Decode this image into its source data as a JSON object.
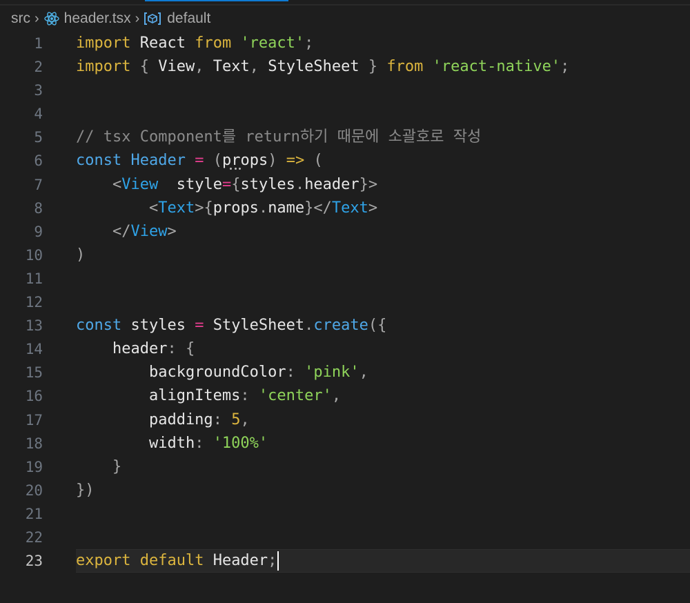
{
  "breadcrumb": {
    "folder": "src",
    "file": "header.tsx",
    "symbol": "default"
  },
  "icons": {
    "file": "react-icon",
    "symbol": "symbol-module-icon",
    "separator": "chevron-right-icon"
  },
  "colors": {
    "keyword": "#dcb53e",
    "string": "#8fd45a",
    "tag": "#2fa3e8",
    "comment": "#8b8b8b",
    "tab_accent": "#0e7ad3"
  },
  "editor": {
    "current_line": 23,
    "lines": [
      {
        "n": "1",
        "tokens": [
          [
            "kw",
            "import"
          ],
          [
            "id",
            " React "
          ],
          [
            "kw",
            "from"
          ],
          [
            "id",
            " "
          ],
          [
            "str",
            "'react'"
          ],
          [
            "punct",
            ";"
          ]
        ]
      },
      {
        "n": "2",
        "tokens": [
          [
            "kw",
            "import"
          ],
          [
            "punct",
            " { "
          ],
          [
            "id",
            "View"
          ],
          [
            "punct",
            ", "
          ],
          [
            "id",
            "Text"
          ],
          [
            "punct",
            ", "
          ],
          [
            "id",
            "StyleSheet"
          ],
          [
            "punct",
            " } "
          ],
          [
            "kw",
            "from"
          ],
          [
            "id",
            " "
          ],
          [
            "str",
            "'react-native'"
          ],
          [
            "punct",
            ";"
          ]
        ]
      },
      {
        "n": "3",
        "tokens": []
      },
      {
        "n": "4",
        "tokens": []
      },
      {
        "n": "5",
        "tokens": [
          [
            "comment",
            "// tsx Component를 return하기 때문에 소괄호로 작성"
          ]
        ]
      },
      {
        "n": "6",
        "tokens": [
          [
            "const",
            "const"
          ],
          [
            "id",
            " "
          ],
          [
            "fn",
            "Header"
          ],
          [
            "id",
            " "
          ],
          [
            "op",
            "="
          ],
          [
            "id",
            " "
          ],
          [
            "punct",
            "("
          ],
          [
            "id",
            "props"
          ],
          [
            "punct",
            ")"
          ],
          [
            "id",
            " "
          ],
          [
            "arrow",
            "=>"
          ],
          [
            "id",
            " "
          ],
          [
            "punct",
            "("
          ]
        ]
      },
      {
        "n": "7",
        "tokens": [
          [
            "id",
            "    "
          ],
          [
            "punct",
            "<"
          ],
          [
            "tag",
            "View"
          ],
          [
            "id",
            "  "
          ],
          [
            "prop",
            "style"
          ],
          [
            "op",
            "="
          ],
          [
            "punct",
            "{"
          ],
          [
            "id",
            "styles"
          ],
          [
            "punct",
            "."
          ],
          [
            "id",
            "header"
          ],
          [
            "punct",
            "}>"
          ]
        ]
      },
      {
        "n": "8",
        "tokens": [
          [
            "id",
            "        "
          ],
          [
            "punct",
            "<"
          ],
          [
            "tag",
            "Text"
          ],
          [
            "punct",
            ">{"
          ],
          [
            "id",
            "props"
          ],
          [
            "punct",
            "."
          ],
          [
            "id",
            "name"
          ],
          [
            "punct",
            "}</"
          ],
          [
            "tag",
            "Text"
          ],
          [
            "punct",
            ">"
          ]
        ]
      },
      {
        "n": "9",
        "tokens": [
          [
            "id",
            "    "
          ],
          [
            "punct",
            "</"
          ],
          [
            "tag",
            "View"
          ],
          [
            "punct",
            ">"
          ]
        ]
      },
      {
        "n": "10",
        "tokens": [
          [
            "punct",
            ")"
          ]
        ]
      },
      {
        "n": "11",
        "tokens": []
      },
      {
        "n": "12",
        "tokens": []
      },
      {
        "n": "13",
        "tokens": [
          [
            "const",
            "const"
          ],
          [
            "id",
            " styles "
          ],
          [
            "op",
            "="
          ],
          [
            "id",
            " StyleSheet"
          ],
          [
            "punct",
            "."
          ],
          [
            "fn",
            "create"
          ],
          [
            "punct",
            "({"
          ]
        ]
      },
      {
        "n": "14",
        "tokens": [
          [
            "id",
            "    header"
          ],
          [
            "punct",
            ": {"
          ]
        ]
      },
      {
        "n": "15",
        "tokens": [
          [
            "id",
            "        backgroundColor"
          ],
          [
            "punct",
            ": "
          ],
          [
            "str",
            "'pink'"
          ],
          [
            "punct",
            ","
          ]
        ]
      },
      {
        "n": "16",
        "tokens": [
          [
            "id",
            "        alignItems"
          ],
          [
            "punct",
            ": "
          ],
          [
            "str",
            "'center'"
          ],
          [
            "punct",
            ","
          ]
        ]
      },
      {
        "n": "17",
        "tokens": [
          [
            "id",
            "        padding"
          ],
          [
            "punct",
            ": "
          ],
          [
            "num",
            "5"
          ],
          [
            "punct",
            ","
          ]
        ]
      },
      {
        "n": "18",
        "tokens": [
          [
            "id",
            "        width"
          ],
          [
            "punct",
            ": "
          ],
          [
            "str",
            "'100%'"
          ]
        ]
      },
      {
        "n": "19",
        "tokens": [
          [
            "punct",
            "    }"
          ]
        ]
      },
      {
        "n": "20",
        "tokens": [
          [
            "punct",
            "})"
          ]
        ]
      },
      {
        "n": "21",
        "tokens": []
      },
      {
        "n": "22",
        "tokens": []
      },
      {
        "n": "23",
        "tokens": [
          [
            "kw",
            "export"
          ],
          [
            "id",
            " "
          ],
          [
            "kw",
            "default"
          ],
          [
            "id",
            " Header"
          ],
          [
            "punct",
            ";"
          ]
        ]
      }
    ]
  }
}
